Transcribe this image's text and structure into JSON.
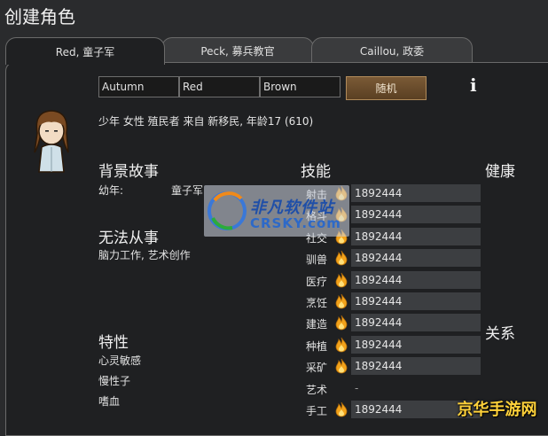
{
  "header": {
    "title": "创建角色"
  },
  "tabs": [
    {
      "label": "Red, 童子军"
    },
    {
      "label": "Peck, 募兵教官"
    },
    {
      "label": "Caillou, 政委"
    }
  ],
  "name_fields": {
    "first": "Autumn",
    "nick": "Red",
    "last": "Brown"
  },
  "random_button": "随机",
  "description": "少年 女性 殖民者 来自 新移民, 年龄17 (610)",
  "backstory": {
    "title": "背景故事",
    "childhood_label": "幼年:",
    "childhood_value": "童子军"
  },
  "incapable": {
    "title": "无法从事",
    "items": "脑力工作, 艺术创作"
  },
  "traits": {
    "title": "特性",
    "items": [
      "心灵敏感",
      "慢性子",
      "嗜血"
    ]
  },
  "skills": {
    "title": "技能",
    "list": [
      {
        "name": "射击",
        "value": "1892444",
        "passion": true
      },
      {
        "name": "格斗",
        "value": "1892444",
        "passion": true
      },
      {
        "name": "社交",
        "value": "1892444",
        "passion": true
      },
      {
        "name": "驯兽",
        "value": "1892444",
        "passion": true
      },
      {
        "name": "医疗",
        "value": "1892444",
        "passion": true
      },
      {
        "name": "烹饪",
        "value": "1892444",
        "passion": true
      },
      {
        "name": "建造",
        "value": "1892444",
        "passion": true
      },
      {
        "name": "种植",
        "value": "1892444",
        "passion": true
      },
      {
        "name": "采矿",
        "value": "1892444",
        "passion": true
      },
      {
        "name": "艺术",
        "value": "-",
        "passion": false
      },
      {
        "name": "手工",
        "value": "1892444",
        "passion": true
      }
    ]
  },
  "health": {
    "title": "健康"
  },
  "relations": {
    "title": "关系"
  },
  "watermark": {
    "line1": "非凡软件站",
    "line2": "CRSKY.com",
    "corner": "京华手游网"
  },
  "icons": {
    "info": "info-icon",
    "passion": "flame-icon",
    "portrait": "pawn-portrait"
  },
  "colors": {
    "random_button": "#6b4c2c",
    "skill_bar": "#3c3e41",
    "flame": "#f2a21a"
  }
}
